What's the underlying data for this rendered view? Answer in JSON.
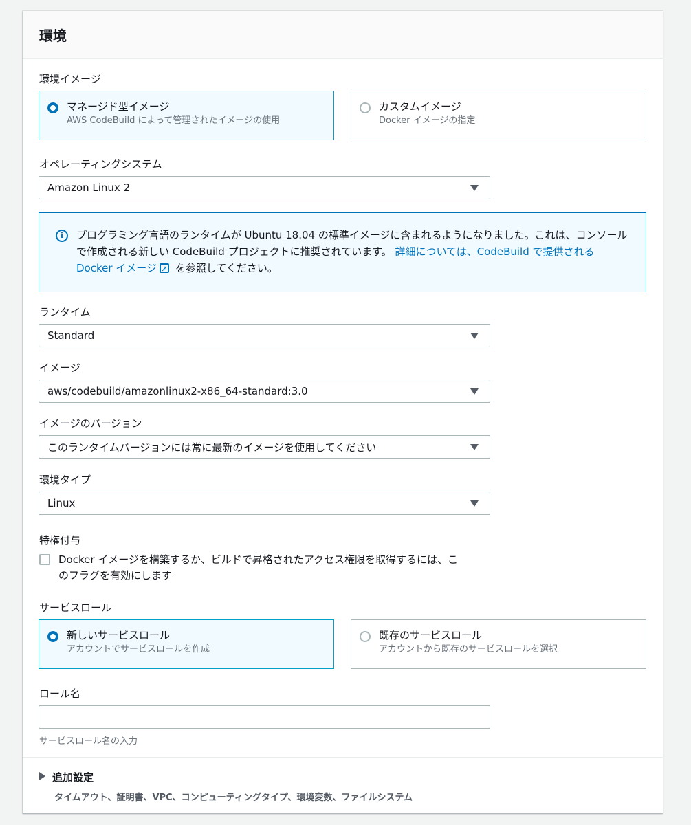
{
  "panel": {
    "title": "環境"
  },
  "env_image": {
    "label": "環境イメージ",
    "options": [
      {
        "title": "マネージド型イメージ",
        "desc": "AWS CodeBuild によって管理されたイメージの使用",
        "selected": true
      },
      {
        "title": "カスタムイメージ",
        "desc": "Docker イメージの指定",
        "selected": false
      }
    ]
  },
  "os": {
    "label": "オペレーティングシステム",
    "value": "Amazon Linux 2"
  },
  "info": {
    "text": "プログラミング言語のランタイムが Ubuntu 18.04 の標準イメージに含まれるようになりました。これは、コンソールで作成される新しい CodeBuild プロジェクトに推奨されています。",
    "link_text": "詳細については、CodeBuild で提供される Docker イメージ",
    "suffix": "を参照してください。"
  },
  "runtime": {
    "label": "ランタイム",
    "value": "Standard"
  },
  "image": {
    "label": "イメージ",
    "value": "aws/codebuild/amazonlinux2-x86_64-standard:3.0"
  },
  "image_version": {
    "label": "イメージのバージョン",
    "value": "このランタイムバージョンには常に最新のイメージを使用してください"
  },
  "env_type": {
    "label": "環境タイプ",
    "value": "Linux"
  },
  "privileged": {
    "label": "特権付与",
    "checkbox_line1": "Docker イメージを構築するか、ビルドで昇格されたアクセス権限を取得するには、こ",
    "checkbox_line2": "のフラグを有効にします",
    "checked": false
  },
  "service_role": {
    "label": "サービスロール",
    "options": [
      {
        "title": "新しいサービスロール",
        "desc": "アカウントでサービスロールを作成",
        "selected": true
      },
      {
        "title": "既存のサービスロール",
        "desc": "アカウントから既存のサービスロールを選択",
        "selected": false
      }
    ]
  },
  "role_name": {
    "label": "ロール名",
    "value": "",
    "hint": "サービスロール名の入力"
  },
  "additional": {
    "title": "追加設定",
    "desc": "タイムアウト、証明書、VPC、コンピューティングタイプ、環境変数、ファイルシステム"
  }
}
